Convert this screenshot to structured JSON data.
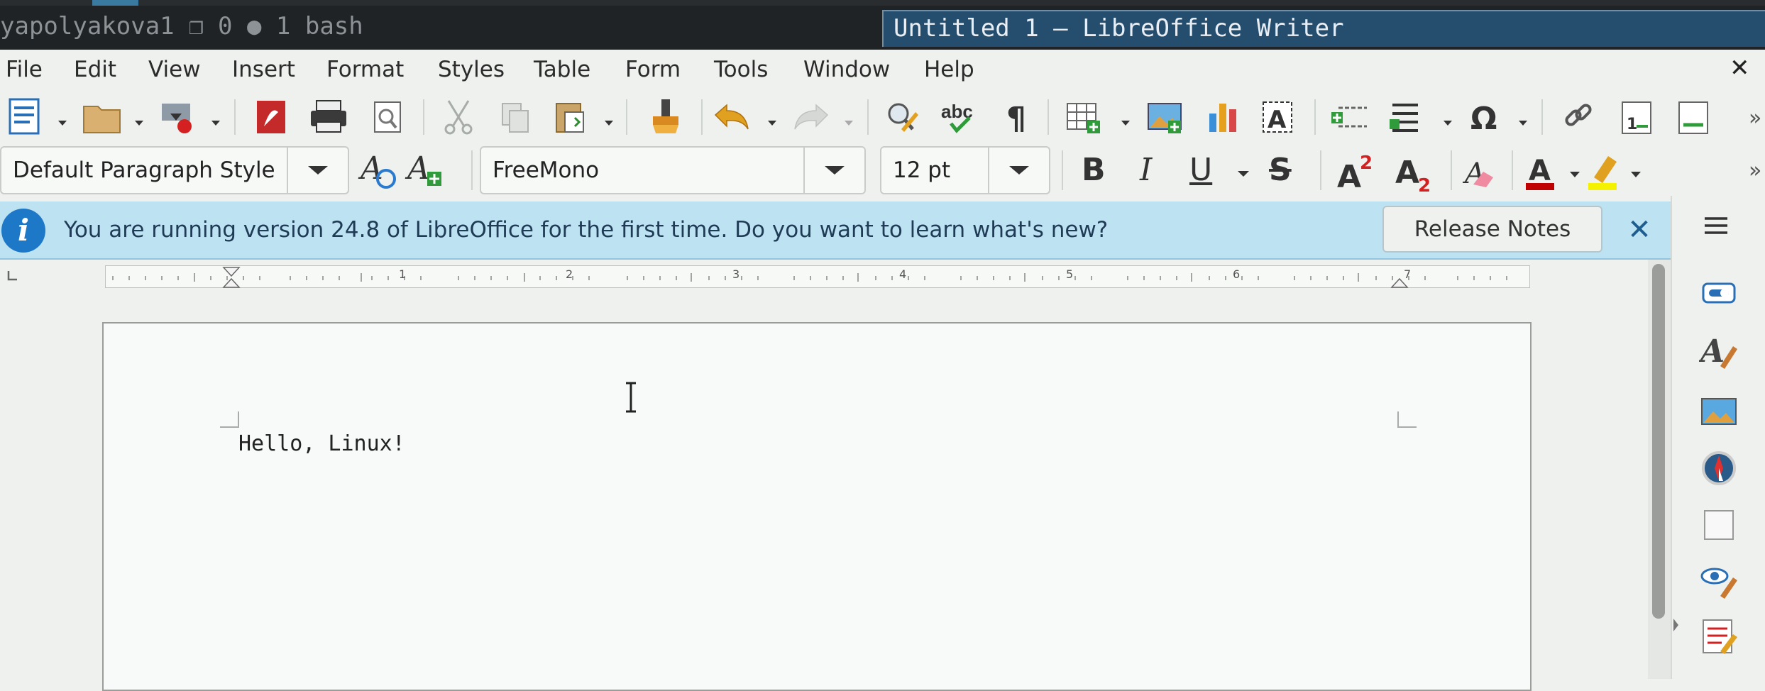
{
  "terminal_title": "yapolyakova1 ❐ 0 ● 1 bash",
  "window_title": "Untitled 1 — LibreOffice Writer",
  "menu": [
    "File",
    "Edit",
    "View",
    "Insert",
    "Format",
    "Styles",
    "Table",
    "Form",
    "Tools",
    "Window",
    "Help"
  ],
  "doc_close": "✕",
  "formatting": {
    "paragraph_style": "Default Paragraph Style",
    "font_name": "FreeMono",
    "font_size": "12 pt",
    "bold": "B",
    "italic": "I",
    "underline": "U",
    "strike": "S",
    "font_color": "#c00000",
    "highlight_color": "#f5f200"
  },
  "infobar": {
    "message": "You are running version 24.8 of LibreOffice for the first time. Do you want to learn what's new?",
    "button": "Release Notes",
    "close": "✕",
    "icon": "i"
  },
  "ruler_labels": [
    "1",
    "2",
    "3",
    "4",
    "5",
    "6",
    "7"
  ],
  "document": {
    "text": "Hello, Linux!"
  },
  "icons": {
    "toolbar1": [
      "new-document-icon",
      "open-folder-icon",
      "save-icon",
      "export-pdf-icon",
      "print-icon",
      "print-preview-icon",
      "cut-icon",
      "copy-icon",
      "paste-icon",
      "clone-formatting-icon",
      "undo-icon",
      "redo-icon",
      "find-replace-icon",
      "spelling-icon",
      "formatting-marks-icon",
      "insert-table-icon",
      "insert-image-icon",
      "insert-chart-icon",
      "insert-textbox-icon",
      "page-break-icon",
      "insert-field-icon",
      "special-character-icon",
      "hyperlink-icon",
      "footnote-icon",
      "header-footer-icon"
    ],
    "sidebar": [
      "sidebar-menu-icon",
      "properties-icon",
      "styles-icon",
      "gallery-icon",
      "navigator-icon",
      "page-icon",
      "style-inspector-icon",
      "manage-changes-icon"
    ]
  }
}
